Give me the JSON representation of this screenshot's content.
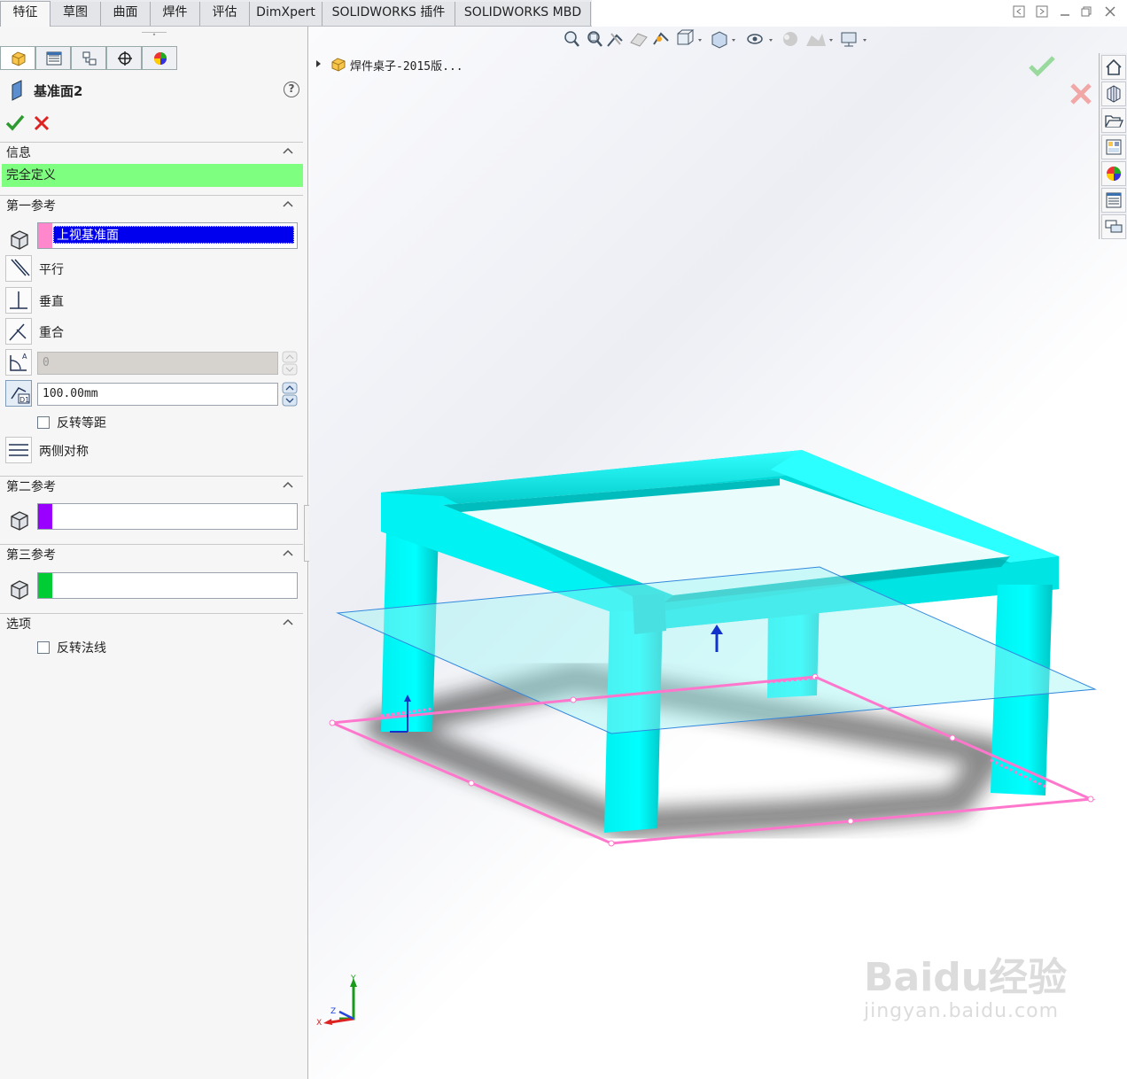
{
  "tabs": [
    {
      "label": "特征",
      "active": true
    },
    {
      "label": "草图",
      "active": false
    },
    {
      "label": "曲面",
      "active": false
    },
    {
      "label": "焊件",
      "active": false
    },
    {
      "label": "评估",
      "active": false
    },
    {
      "label": "DimXpert",
      "active": false
    },
    {
      "label": "SOLIDWORKS 插件",
      "active": false
    },
    {
      "label": "SOLIDWORKS MBD",
      "active": false
    }
  ],
  "manager_tabs": [
    "featuremanager-icon",
    "propertymanager-icon",
    "configurationmanager-icon",
    "dimxpertmanager-icon",
    "displaymanager-icon"
  ],
  "property_manager": {
    "title": "基准面2",
    "info": {
      "header": "信息",
      "status": "完全定义",
      "status_color": "#7fff7f"
    },
    "first_ref": {
      "header": "第一参考",
      "selection": "上视基准面",
      "swatch_color": "#ff88cc",
      "options": {
        "parallel": "平行",
        "perpendicular": "垂直",
        "coincident": "重合"
      },
      "angle_value": "0",
      "offset_value": "100.00mm",
      "flip_offset": "反转等距",
      "mid_plane": "两侧对称"
    },
    "second_ref": {
      "header": "第二参考",
      "swatch_color": "#9900ff",
      "selection": ""
    },
    "third_ref": {
      "header": "第三参考",
      "swatch_color": "#00cc33",
      "selection": ""
    },
    "options": {
      "header": "选项",
      "flip_normal": "反转法线"
    }
  },
  "tree": {
    "root_label": "焊件桌子-2015版..."
  },
  "model": {
    "color": "#00ffff",
    "plane_color": "#ff77cc",
    "preview_plane_color": "#9ff3f3"
  },
  "triad": {
    "x": "X",
    "y": "Y",
    "z": "Z"
  },
  "watermark": {
    "brand": "Baidu经验",
    "url": "jingyan.baidu.com"
  }
}
